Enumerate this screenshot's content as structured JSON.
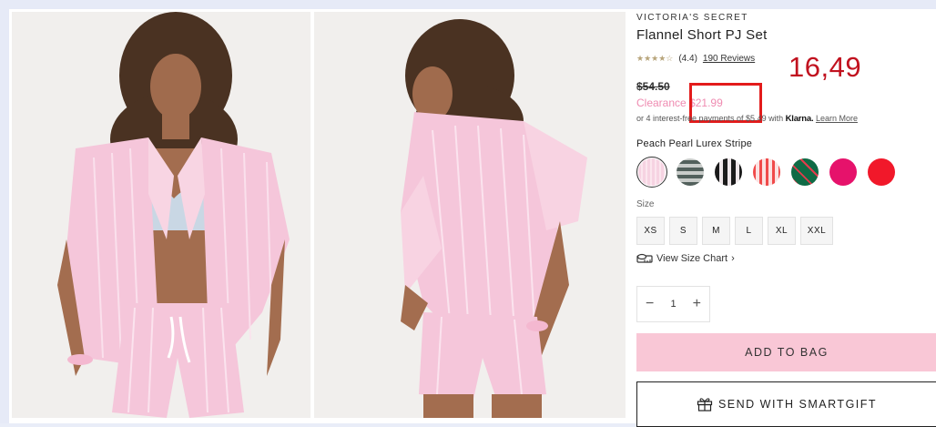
{
  "product": {
    "brand": "VICTORIA'S SECRET",
    "title": "Flannel Short PJ Set",
    "rating_value": "(4.4)",
    "reviews_link": "190 Reviews",
    "original_price": "$54.50",
    "clearance_label": "Clearance",
    "clearance_price": "$21.99",
    "klarna_prefix": "or 4 interest-free payments of $5.49 with",
    "klarna_brand": "Klarna.",
    "klarna_link": "Learn More"
  },
  "annotation": {
    "value": "16,49",
    "color": "#c1121f"
  },
  "color": {
    "selected_name": "Peach Pearl Lurex Stripe",
    "swatches": [
      "pink-stripe",
      "gray-plaid",
      "black-stripe",
      "red-plaid",
      "green-plaid",
      "magenta-dot",
      "red"
    ]
  },
  "sizes": {
    "label": "Size",
    "options": [
      "XS",
      "S",
      "M",
      "L",
      "XL",
      "XXL"
    ]
  },
  "size_chart": {
    "label": "View Size Chart",
    "chevron": "›"
  },
  "quantity": {
    "minus": "−",
    "value": "1",
    "plus": "+"
  },
  "actions": {
    "add_to_bag": "ADD TO BAG",
    "smartgift": "SEND WITH SMARTGIFT"
  },
  "colors": {
    "accent_pink": "#f9c7d6",
    "clearance_pink": "#ef8bb1",
    "highlight_red": "#e31b1b"
  }
}
